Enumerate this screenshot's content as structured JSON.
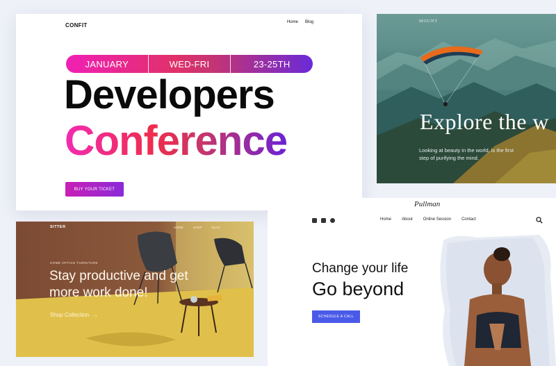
{
  "conference": {
    "logo": "CONFIT",
    "nav": [
      "Home",
      "Blog"
    ],
    "dates": [
      "JANUARY",
      "WED-FRI",
      "23-25TH"
    ],
    "title_line1": "Developers",
    "title_line2": "Conference",
    "cta": "BUY YOUR TICKET"
  },
  "mountain": {
    "brand": "MOUNT",
    "hero": "Explore the w",
    "subtitle": "Looking at beauty in the world, is the first step of purifying the mind."
  },
  "furniture": {
    "logo": "SITTER",
    "nav": [
      "HOME",
      "SHOP",
      "BLOG"
    ],
    "eyebrow": "HOME OFFICE FURNITURE",
    "hero": "Stay productive and get more work done!",
    "link": "Shop Collection",
    "link_arrow": "→"
  },
  "wellness": {
    "brand": "Pullman",
    "nav": [
      "Home",
      "About",
      "Online Session",
      "Contact"
    ],
    "heading": "Change your life",
    "subheading": "Go beyond",
    "cta": "SCHEDULE A CALL",
    "social_icons": [
      "youtube-icon",
      "linkedin-icon",
      "globe-icon"
    ]
  },
  "colors": {
    "accent_magenta": "#f020b4",
    "accent_purple": "#6b21d6",
    "accent_blue": "#4a5ae8"
  }
}
